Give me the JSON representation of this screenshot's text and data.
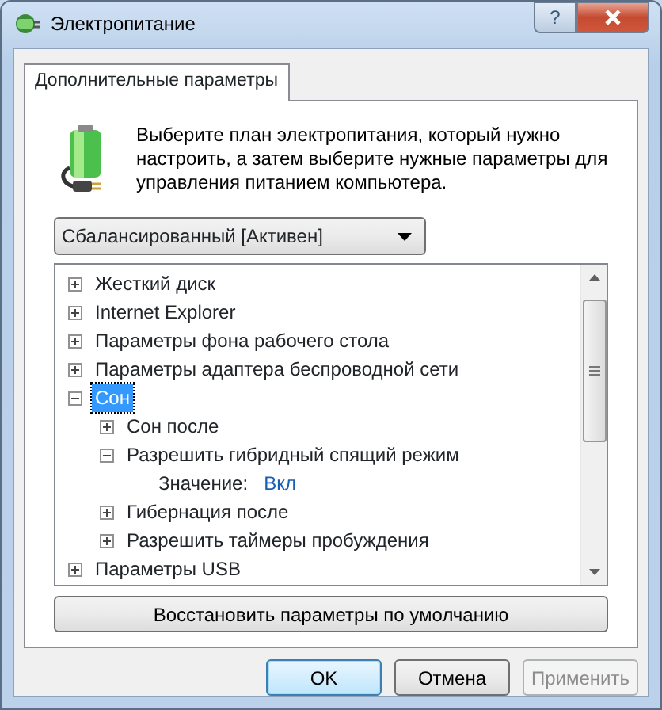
{
  "window": {
    "title": "Электропитание",
    "help_glyph": "?"
  },
  "tabs": [
    {
      "label": "Дополнительные параметры",
      "selected": true
    }
  ],
  "description": "Выберите план электропитания, который нужно настроить, а затем выберите нужные параметры для управления питанием компьютера.",
  "plan_dropdown": {
    "value": "Сбалансированный [Активен]"
  },
  "tree": [
    {
      "label": "Жесткий диск",
      "expanded": false,
      "selected": false
    },
    {
      "label": "Internet Explorer",
      "expanded": false,
      "selected": false
    },
    {
      "label": "Параметры фона рабочего стола",
      "expanded": false,
      "selected": false
    },
    {
      "label": "Параметры адаптера беспроводной сети",
      "expanded": false,
      "selected": false
    },
    {
      "label": "Сон",
      "expanded": true,
      "selected": true,
      "children": [
        {
          "label": "Сон после",
          "expanded": false,
          "selected": false
        },
        {
          "label": "Разрешить гибридный спящий режим",
          "expanded": true,
          "selected": false,
          "children": [
            {
              "kind": "value",
              "label": "Значение:",
              "value": "Вкл"
            }
          ]
        },
        {
          "label": "Гибернация после",
          "expanded": false,
          "selected": false
        },
        {
          "label": "Разрешить таймеры пробуждения",
          "expanded": false,
          "selected": false
        }
      ]
    },
    {
      "label": "Параметры USB",
      "expanded": false,
      "selected": false
    }
  ],
  "restore_button": "Восстановить параметры по умолчанию",
  "buttons": [
    {
      "label": "OK",
      "default": true,
      "disabled": false
    },
    {
      "label": "Отмена",
      "default": false,
      "disabled": false
    },
    {
      "label": "Применить",
      "default": false,
      "disabled": true
    }
  ]
}
